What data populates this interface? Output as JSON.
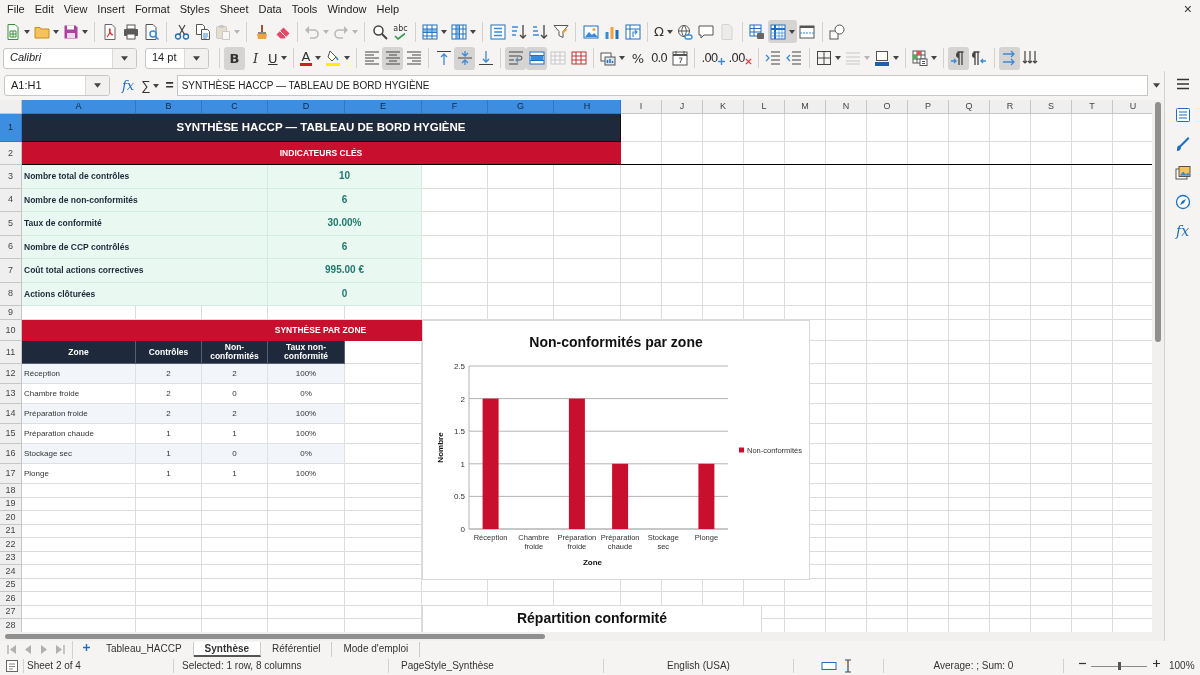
{
  "menu_bar": {
    "items": [
      "File",
      "Edit",
      "View",
      "Insert",
      "Format",
      "Styles",
      "Sheet",
      "Data",
      "Tools",
      "Window",
      "Help"
    ],
    "close_glyph": "×"
  },
  "standard_toolbar": {
    "groups": [
      [
        {
          "kind": "new",
          "dropdown": true,
          "pressed": false,
          "disabled": false
        },
        {
          "kind": "open",
          "dropdown": true,
          "pressed": false,
          "disabled": false
        },
        {
          "kind": "save",
          "dropdown": true,
          "pressed": false,
          "disabled": false
        }
      ],
      [
        {
          "kind": "pdf",
          "pressed": false,
          "disabled": false
        },
        {
          "kind": "print",
          "pressed": false,
          "disabled": false
        },
        {
          "kind": "preview",
          "pressed": false,
          "disabled": false
        }
      ],
      [
        {
          "kind": "cut",
          "pressed": false,
          "disabled": false
        },
        {
          "kind": "copy",
          "pressed": false,
          "disabled": false
        },
        {
          "kind": "paste",
          "dropdown": true,
          "pressed": false,
          "disabled": true
        }
      ],
      [
        {
          "kind": "clone",
          "pressed": false,
          "disabled": false
        },
        {
          "kind": "clear",
          "pressed": false,
          "disabled": false
        }
      ],
      [
        {
          "kind": "undo",
          "dropdown": true,
          "pressed": false,
          "disabled": true
        },
        {
          "kind": "redo",
          "dropdown": true,
          "pressed": false,
          "disabled": true
        }
      ],
      [
        {
          "kind": "find",
          "pressed": false,
          "disabled": false
        },
        {
          "kind": "spelling",
          "label": "abc",
          "pressed": false,
          "disabled": false
        }
      ],
      [
        {
          "kind": "row",
          "dropdown": true,
          "pressed": false,
          "disabled": false
        },
        {
          "kind": "column",
          "dropdown": true,
          "pressed": false,
          "disabled": false
        }
      ],
      [
        {
          "kind": "sort",
          "pressed": false,
          "disabled": false
        },
        {
          "kind": "sortasc",
          "pressed": false,
          "disabled": false
        },
        {
          "kind": "sortdesc",
          "pressed": false,
          "disabled": false
        },
        {
          "kind": "filter",
          "pressed": false,
          "disabled": false
        }
      ],
      [
        {
          "kind": "image",
          "pressed": false,
          "disabled": false
        },
        {
          "kind": "chart",
          "pressed": false,
          "disabled": false
        },
        {
          "kind": "pivot",
          "pressed": false,
          "disabled": false
        }
      ],
      [
        {
          "kind": "special",
          "label": "Ω",
          "dropdown": true,
          "pressed": false,
          "disabled": false
        },
        {
          "kind": "link",
          "pressed": false,
          "disabled": false
        },
        {
          "kind": "comment",
          "pressed": false,
          "disabled": false
        },
        {
          "kind": "headerfooter",
          "pressed": false,
          "disabled": true
        }
      ],
      [
        {
          "kind": "printarea",
          "pressed": false,
          "disabled": false
        },
        {
          "kind": "freeze",
          "dropdown": true,
          "pressed": true,
          "disabled": false
        },
        {
          "kind": "split",
          "pressed": false,
          "disabled": false
        }
      ],
      [
        {
          "kind": "shapes",
          "pressed": false,
          "disabled": false
        }
      ]
    ]
  },
  "formatting_toolbar": {
    "font_name": "Calibri",
    "font_size": "14 pt",
    "groups": [
      [
        {
          "kind": "bold",
          "label": "B",
          "pressed": true,
          "disabled": false
        },
        {
          "kind": "italic",
          "label": "I",
          "pressed": false,
          "disabled": false
        },
        {
          "kind": "underline",
          "label": "U",
          "dropdown": true,
          "pressed": false,
          "disabled": false
        }
      ],
      [
        {
          "kind": "fontcolor",
          "label": "A",
          "dropdown": true,
          "pressed": false,
          "disabled": false
        },
        {
          "kind": "highlight",
          "dropdown": true,
          "pressed": false,
          "disabled": false
        }
      ],
      [
        {
          "kind": "alignleft",
          "pressed": false,
          "disabled": false
        },
        {
          "kind": "aligncenter",
          "pressed": true,
          "disabled": false
        },
        {
          "kind": "alignright",
          "pressed": false,
          "disabled": false
        }
      ],
      [
        {
          "kind": "aligntop",
          "pressed": false,
          "disabled": false
        },
        {
          "kind": "alignmiddle",
          "pressed": true,
          "disabled": false
        },
        {
          "kind": "alignbottom",
          "pressed": false,
          "disabled": false
        }
      ],
      [
        {
          "kind": "wrap",
          "pressed": true,
          "disabled": false
        },
        {
          "kind": "mergecenter",
          "pressed": true,
          "disabled": false
        },
        {
          "kind": "merge",
          "pressed": false,
          "disabled": true
        },
        {
          "kind": "unmerge",
          "pressed": false,
          "disabled": false
        }
      ],
      [
        {
          "kind": "currency",
          "dropdown": true,
          "pressed": false,
          "disabled": false
        },
        {
          "kind": "percent",
          "label": "%",
          "pressed": false,
          "disabled": false
        },
        {
          "kind": "number",
          "label": "0.0",
          "pressed": false,
          "disabled": false
        },
        {
          "kind": "date",
          "pressed": false,
          "disabled": false
        }
      ],
      [
        {
          "kind": "adddecimal",
          "label": ".00",
          "pressed": false,
          "disabled": false
        },
        {
          "kind": "deldecimal",
          "label": ".00",
          "pressed": false,
          "disabled": false
        }
      ],
      [
        {
          "kind": "indent",
          "pressed": false,
          "disabled": false
        },
        {
          "kind": "outdent",
          "pressed": false,
          "disabled": false
        }
      ],
      [
        {
          "kind": "borders",
          "dropdown": true,
          "pressed": false,
          "disabled": false
        },
        {
          "kind": "borderstyle",
          "dropdown": true,
          "pressed": false,
          "disabled": true
        },
        {
          "kind": "bordercolor",
          "dropdown": true,
          "pressed": false,
          "disabled": false
        }
      ],
      [
        {
          "kind": "conditional",
          "dropdown": true,
          "pressed": false,
          "disabled": false
        }
      ],
      [
        {
          "kind": "ltr",
          "pressed": true,
          "disabled": false
        },
        {
          "kind": "rtl",
          "pressed": false,
          "disabled": false
        }
      ],
      [
        {
          "kind": "textdir",
          "pressed": true,
          "disabled": false
        },
        {
          "kind": "vertical",
          "pressed": false,
          "disabled": false
        }
      ]
    ]
  },
  "formula_bar": {
    "name_box": "A1:H1",
    "function_glyph": "fx",
    "sum_glyph": "∑",
    "equals_glyph": "=",
    "content": "SYNTHÈSE HACCP — TABLEAU DE BORD HYGIÈNE"
  },
  "sidebar": {
    "function_glyph": "fx"
  },
  "sheet": {
    "columns": [
      {
        "label": "A",
        "selected": true
      },
      {
        "label": "B",
        "selected": true
      },
      {
        "label": "C",
        "selected": true
      },
      {
        "label": "D",
        "selected": true
      },
      {
        "label": "E",
        "selected": true
      },
      {
        "label": "F",
        "selected": true
      },
      {
        "label": "G",
        "selected": true
      },
      {
        "label": "H",
        "selected": true
      },
      {
        "label": "I",
        "selected": false
      },
      {
        "label": "J",
        "selected": false
      },
      {
        "label": "K",
        "selected": false
      },
      {
        "label": "L",
        "selected": false
      },
      {
        "label": "M",
        "selected": false
      },
      {
        "label": "N",
        "selected": false
      },
      {
        "label": "O",
        "selected": false
      },
      {
        "label": "P",
        "selected": false
      },
      {
        "label": "Q",
        "selected": false
      },
      {
        "label": "R",
        "selected": false
      },
      {
        "label": "S",
        "selected": false
      },
      {
        "label": "T",
        "selected": false
      },
      {
        "label": "U",
        "selected": false
      }
    ],
    "rows": [
      {
        "label": "1",
        "selected": true
      },
      {
        "label": "2",
        "selected": false
      },
      {
        "label": "3",
        "selected": false
      },
      {
        "label": "4",
        "selected": false
      },
      {
        "label": "5",
        "selected": false
      },
      {
        "label": "6",
        "selected": false
      },
      {
        "label": "7",
        "selected": false
      },
      {
        "label": "8",
        "selected": false
      },
      {
        "label": "9",
        "selected": false
      },
      {
        "label": "10",
        "selected": false
      },
      {
        "label": "11",
        "selected": false
      },
      {
        "label": "12",
        "selected": false
      },
      {
        "label": "13",
        "selected": false
      },
      {
        "label": "14",
        "selected": false
      },
      {
        "label": "15",
        "selected": false
      },
      {
        "label": "16",
        "selected": false
      },
      {
        "label": "17",
        "selected": false
      },
      {
        "label": "18",
        "selected": false
      },
      {
        "label": "19",
        "selected": false
      },
      {
        "label": "20",
        "selected": false
      },
      {
        "label": "21",
        "selected": false
      },
      {
        "label": "22",
        "selected": false
      },
      {
        "label": "23",
        "selected": false
      },
      {
        "label": "24",
        "selected": false
      },
      {
        "label": "25",
        "selected": false
      },
      {
        "label": "26",
        "selected": false
      },
      {
        "label": "27",
        "selected": false
      },
      {
        "label": "28",
        "selected": false
      }
    ],
    "title": "SYNTHÈSE HACCP — TABLEAU DE BORD HYGIÈNE",
    "indicators": {
      "heading": "INDICATEURS CLÉS",
      "items": [
        {
          "label": "Nombre total de contrôles",
          "value": "10"
        },
        {
          "label": "Nombre de non-conformités",
          "value": "6"
        },
        {
          "label": "Taux de conformité",
          "value": "30.00%"
        },
        {
          "label": "Nombre de CCP contrôlés",
          "value": "6"
        },
        {
          "label": "Coût total actions correctives",
          "value": "995.00 €"
        },
        {
          "label": "Actions clôturées",
          "value": "0"
        }
      ]
    },
    "zones": {
      "heading": "SYNTHÈSE PAR ZONE",
      "columns": [
        "Zone",
        "Contrôles",
        "Non-conformités",
        "Taux non-conformité"
      ],
      "rows": [
        [
          "Réception",
          "2",
          "2",
          "100%"
        ],
        [
          "Chambre froide",
          "2",
          "0",
          "0%"
        ],
        [
          "Préparation froide",
          "2",
          "2",
          "100%"
        ],
        [
          "Préparation chaude",
          "1",
          "1",
          "100%"
        ],
        [
          "Stockage sec",
          "1",
          "0",
          "0%"
        ],
        [
          "Plonge",
          "1",
          "1",
          "100%"
        ]
      ]
    },
    "nonconformity_chart": {
      "chart_data": {
        "type": "bar",
        "title": "Non-conformités par zone",
        "xlabel": "Zone",
        "ylabel": "Nombre",
        "categories": [
          "Réception",
          "Chambre froide",
          "Préparation froide",
          "Préparation chaude",
          "Stockage sec",
          "Plonge"
        ],
        "series": [
          {
            "name": "Non-conformités",
            "color": "#c8102e",
            "values": [
              2,
              0,
              2,
              1,
              0,
              1
            ]
          }
        ],
        "ylim": [
          0,
          2.5
        ],
        "yticks": [
          0,
          0.5,
          1,
          1.5,
          2,
          2.5
        ],
        "grid": true
      }
    },
    "conformity_chart": {
      "title": "Répartition conformité"
    }
  },
  "tab_bar": {
    "navigation_disabled": true,
    "tabs": [
      {
        "label": "Tableau_HACCP",
        "selected": false
      },
      {
        "label": "Synthèse",
        "selected": true
      },
      {
        "label": "Référentiel",
        "selected": false
      },
      {
        "label": "Mode d'emploi",
        "selected": false
      }
    ]
  },
  "status_bar": {
    "sheet": "Sheet 2 of 4",
    "selection": "Selected: 1 row, 8 columns",
    "page_style": "PageStyle_Synthèse",
    "language": "English (USA)",
    "summary": "Average: ; Sum: 0",
    "zoom": {
      "level": 0.5,
      "reading": "100%"
    }
  }
}
